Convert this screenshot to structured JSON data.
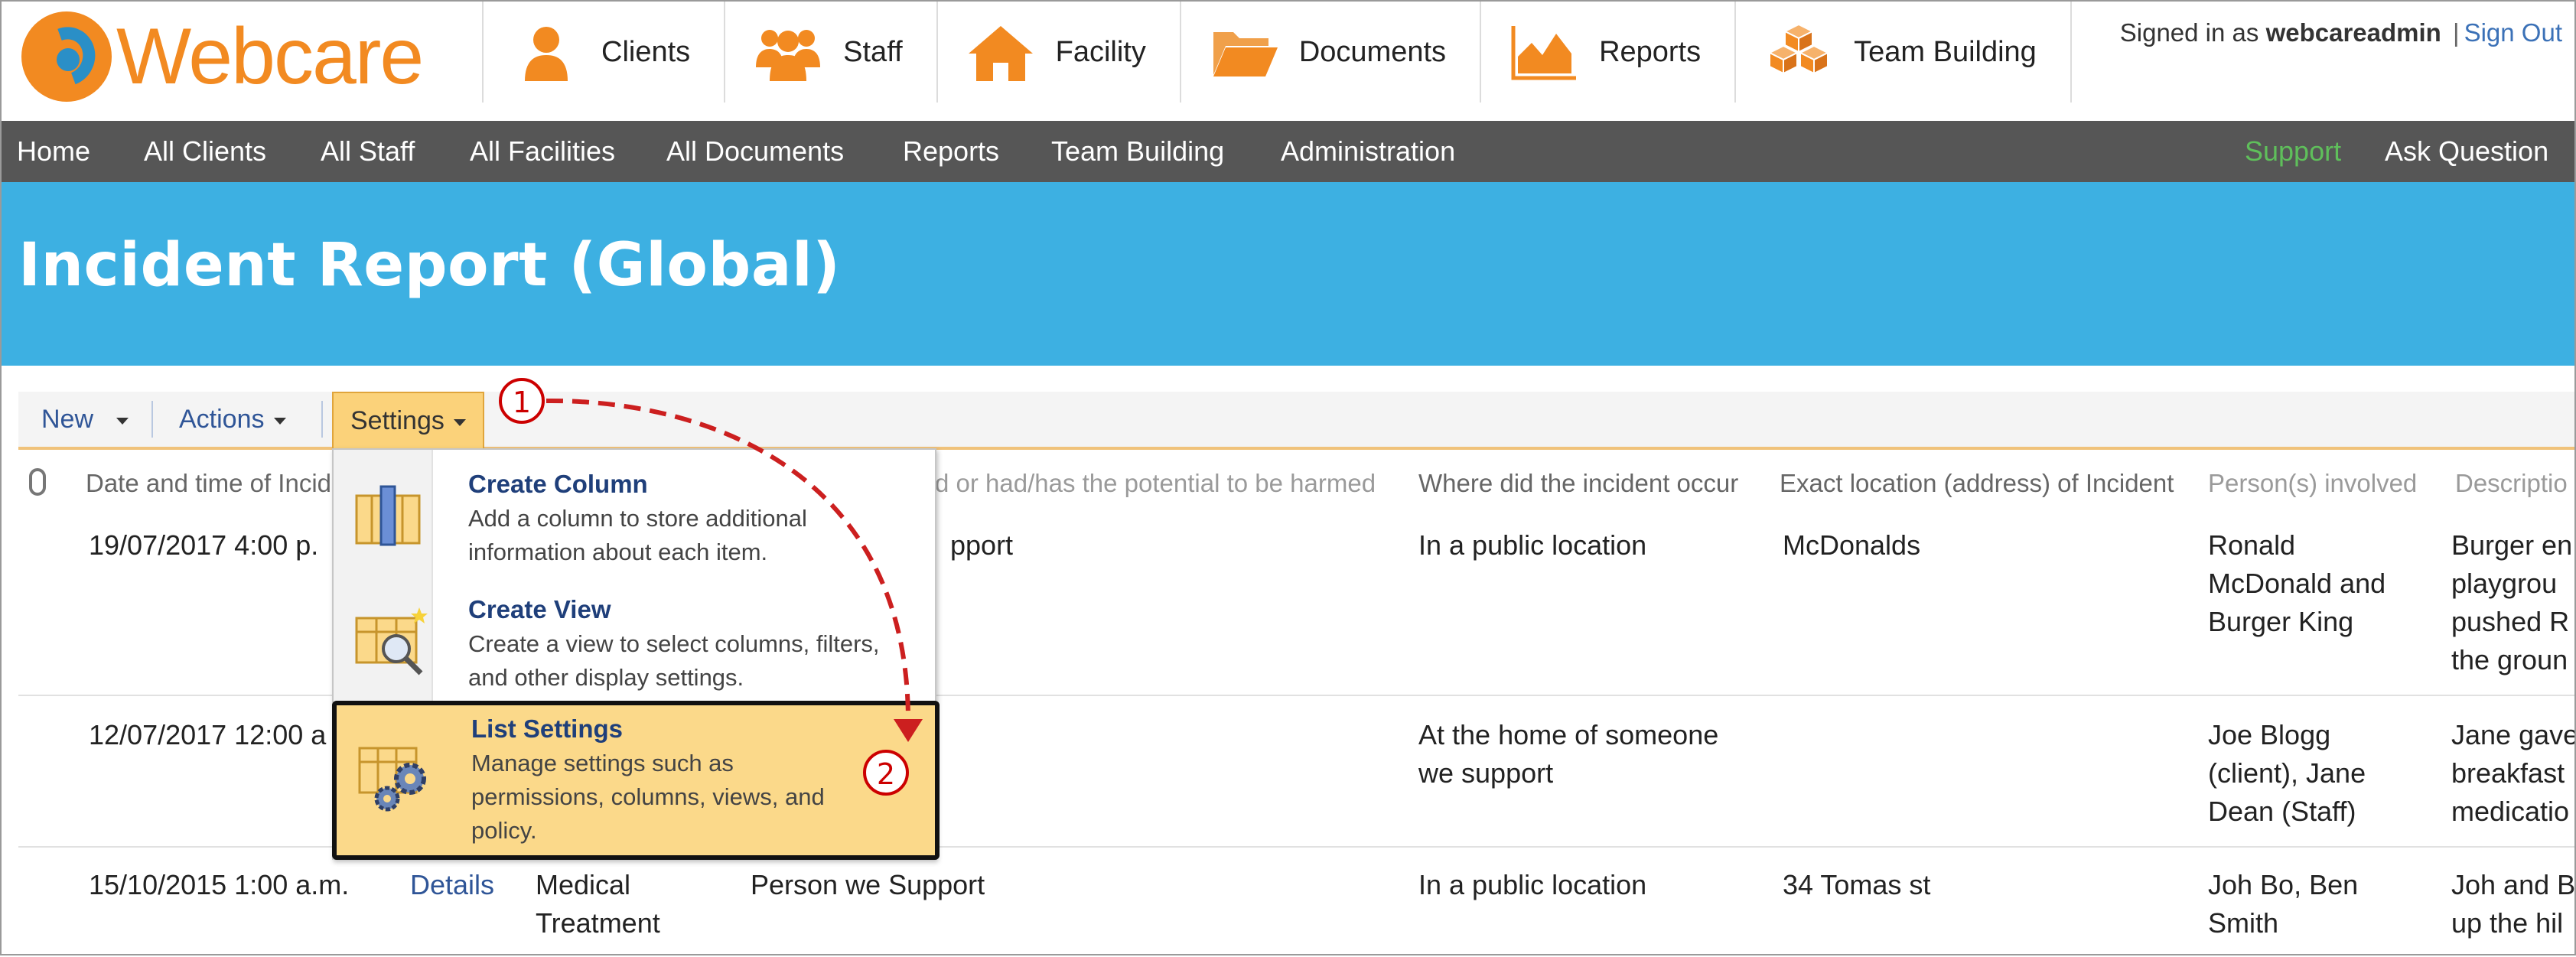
{
  "app": {
    "logo_text": "Webcare",
    "brand_color": "#f28a21",
    "signed_in_prefix": "Signed in as",
    "username": "webcareadmin",
    "separator": "|",
    "sign_out": "Sign Out"
  },
  "main_nav": [
    {
      "label": "Clients",
      "icon": "person-icon"
    },
    {
      "label": "Staff",
      "icon": "group-icon"
    },
    {
      "label": "Facility",
      "icon": "house-icon"
    },
    {
      "label": "Documents",
      "icon": "folder-icon"
    },
    {
      "label": "Reports",
      "icon": "chart-icon"
    },
    {
      "label": "Team Building",
      "icon": "blocks-icon"
    }
  ],
  "sub_nav": {
    "home": "Home",
    "all_clients": "All Clients",
    "all_staff": "All Staff",
    "all_facilities": "All Facilities",
    "all_documents": "All Documents",
    "reports": "Reports",
    "team_building": "Team Building",
    "administration": "Administration",
    "support": "Support",
    "ask_question": "Ask Question"
  },
  "page": {
    "title": "Incident Report (Global)",
    "banner_color": "#3db0e2"
  },
  "toolbar": {
    "new": "New",
    "actions": "Actions",
    "settings": "Settings"
  },
  "settings_menu": {
    "create_column": {
      "title": "Create Column",
      "desc": "Add a column to store additional information about each item."
    },
    "create_view": {
      "title": "Create View",
      "desc": "Create a view to select columns, filters, and other display settings."
    },
    "list_settings": {
      "title": "List Settings",
      "desc": "Manage settings such as permissions, columns, views, and policy."
    }
  },
  "table": {
    "headers": {
      "date_time": "Date and time of Incid",
      "harmed": "d or had/has the potential to be harmed",
      "where": "Where did the incident occur",
      "location": "Exact location (address) of Incident",
      "persons": "Person(s) involved",
      "description": "Descriptio"
    },
    "rows": [
      {
        "date": "19/07/2017 4:00 p.",
        "harmed": "pport",
        "where": "In a public location",
        "location": "McDonalds",
        "persons": [
          "Ronald",
          "McDonald and",
          "Burger King"
        ],
        "description": [
          "Burger en",
          "playgrou",
          "pushed R",
          "the groun"
        ]
      },
      {
        "date": "12/07/2017 12:00 a",
        "where": [
          "At the home of someone",
          "we support"
        ],
        "persons": [
          "Joe Blogg",
          "(client), Jane",
          "Dean (Staff)"
        ],
        "description": [
          "Jane gave",
          "breakfast",
          "medicatio"
        ]
      },
      {
        "date": "15/10/2015 1:00 a.m.",
        "details": "Details",
        "type": [
          "Medical",
          "Treatment"
        ],
        "harmed": "Person we Support",
        "where": "In a public location",
        "location": "34 Tomas st",
        "persons": [
          "Joh Bo, Ben",
          "Smith"
        ],
        "description": [
          "Joh and B",
          "up the hil"
        ]
      }
    ]
  },
  "annotations": {
    "step1": "1",
    "step2": "2",
    "arrow_color": "#cc1f1f"
  }
}
